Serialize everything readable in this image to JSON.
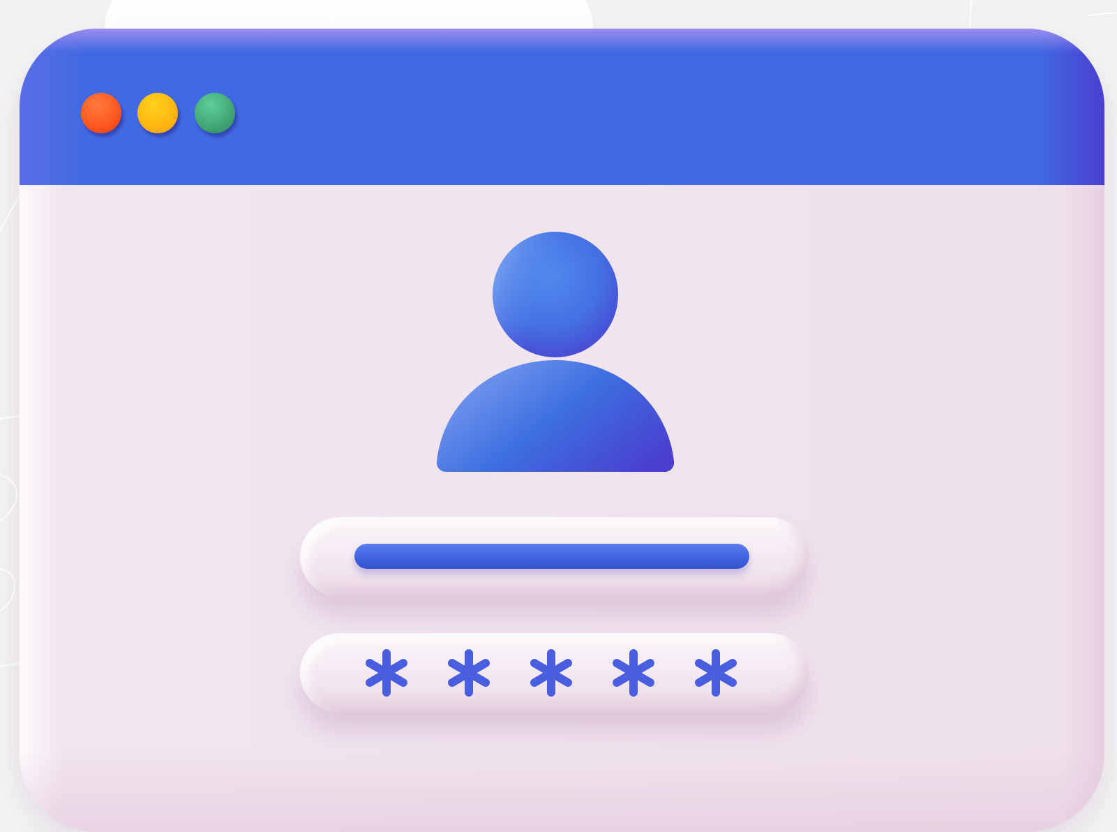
{
  "window": {
    "traffic_lights": [
      {
        "name": "close",
        "color": "#ff5a22"
      },
      {
        "name": "minimize",
        "color": "#ffb812"
      },
      {
        "name": "maximize",
        "color": "#43a877"
      }
    ],
    "titlebar_color": "#4169e1",
    "body_color": "#f0e4ee"
  },
  "login": {
    "avatar_icon": "user-icon",
    "username_field": {
      "value_indicator": "filled-bar",
      "accent": "#4169e1"
    },
    "password_field": {
      "masked_value": "*****",
      "mask_icon": "asterisk-icon",
      "mask_count": 5
    }
  }
}
